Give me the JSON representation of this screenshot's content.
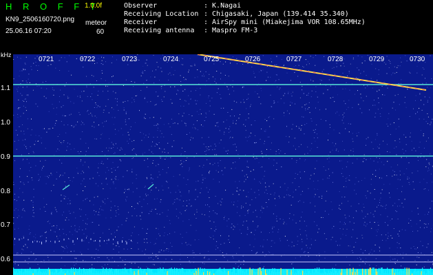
{
  "header": {
    "title": "H R O F F T",
    "version": "1.0.0f",
    "filename": "KN9_2506160720.png",
    "mode": "meteor",
    "timestamp": "25.06.16 07:20",
    "count": "60"
  },
  "info": [
    {
      "key": "Observer",
      "value": ": K.Nagai"
    },
    {
      "key": "Receiving Location",
      "value": ": Chigasaki, Japan (139.414 35.340)"
    },
    {
      "key": "Receiver",
      "value": ": AirSpy mini (Miakejima VOR 108.65MHz)"
    },
    {
      "key": "Receiving antenna",
      "value": ": Maspro FM-3"
    }
  ],
  "axis": {
    "y_unit": "kHz",
    "y_ticks": [
      "1.1",
      "1.0",
      "0.9",
      "0.8",
      "0.7",
      "0.6"
    ],
    "x_ticks": [
      "0721",
      "0722",
      "0723",
      "0724",
      "0725",
      "0726",
      "0727",
      "0728",
      "0729",
      "0730"
    ]
  },
  "colors": {
    "background": "#000000",
    "spectrogram": "#0a1a8c",
    "title": "#00ff00",
    "version": "#ffff00",
    "carrier_line": "#56e8d8",
    "meteor_trail": "#ffd94a",
    "baseline": "#00e5ff"
  }
}
